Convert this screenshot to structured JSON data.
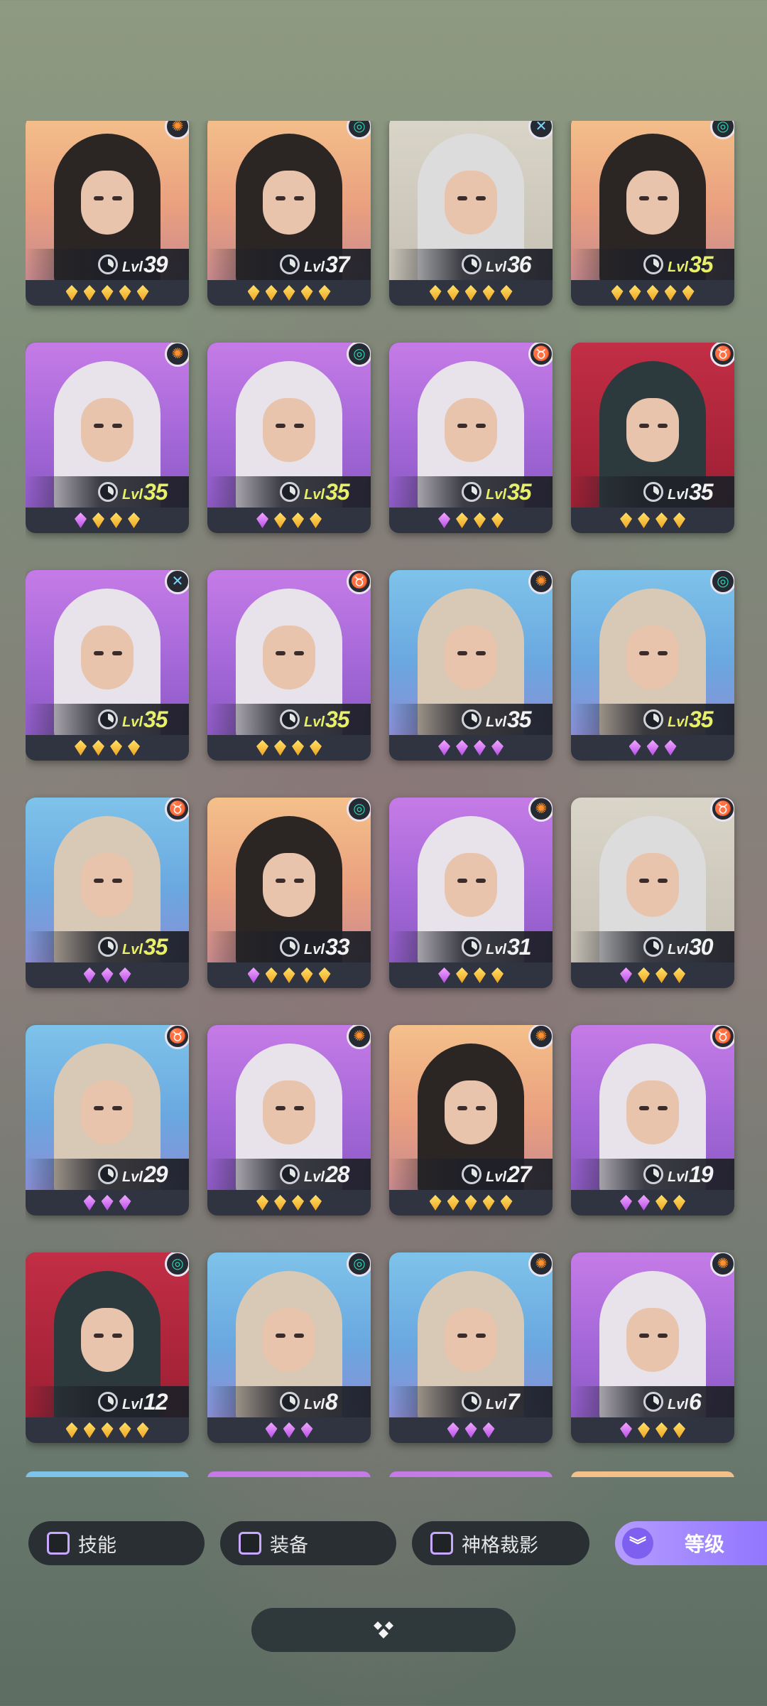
{
  "colors": {
    "level_highlight": "#e8f06a",
    "gem_gold": "#f0a321",
    "gem_purple": "#b74ee6",
    "sort_accent": "#8f73ff"
  },
  "heroes": [
    {
      "level_prefix": "Lvl",
      "level": "39",
      "faction": "orange",
      "faction_icon": "sun-icon",
      "bg": "orange",
      "gems": [
        "gold",
        "gold",
        "gold",
        "gold",
        "gold"
      ],
      "level_white": true
    },
    {
      "level_prefix": "Lvl",
      "level": "37",
      "faction": "teal",
      "faction_icon": "swirl-icon",
      "bg": "orange",
      "gems": [
        "gold",
        "gold",
        "gold",
        "gold",
        "gold"
      ],
      "level_white": true
    },
    {
      "level_prefix": "Lvl",
      "level": "36",
      "faction": "cyan",
      "faction_icon": "cross-icon",
      "bg": "gray",
      "gems": [
        "gold",
        "gold",
        "gold",
        "gold",
        "gold"
      ],
      "level_white": true
    },
    {
      "level_prefix": "Lvl",
      "level": "35",
      "faction": "teal",
      "faction_icon": "swirl-icon",
      "bg": "orange",
      "gems": [
        "gold",
        "gold",
        "gold",
        "gold",
        "gold"
      ],
      "level_white": false
    },
    {
      "level_prefix": "Lvl",
      "level": "35",
      "faction": "orange",
      "faction_icon": "sun-icon",
      "bg": "purple",
      "gems": [
        "purple",
        "gold",
        "gold",
        "gold"
      ],
      "level_white": false
    },
    {
      "level_prefix": "Lvl",
      "level": "35",
      "faction": "teal",
      "faction_icon": "swirl-icon",
      "bg": "purple",
      "gems": [
        "purple",
        "gold",
        "gold",
        "gold"
      ],
      "level_white": false
    },
    {
      "level_prefix": "Lvl",
      "level": "35",
      "faction": "purple",
      "faction_icon": "horns-icon",
      "bg": "purple",
      "gems": [
        "purple",
        "gold",
        "gold",
        "gold"
      ],
      "level_white": false
    },
    {
      "level_prefix": "Lvl",
      "level": "35",
      "faction": "purple",
      "faction_icon": "horns-icon",
      "bg": "red",
      "gems": [
        "gold",
        "gold",
        "gold",
        "gold"
      ],
      "level_white": true
    },
    {
      "level_prefix": "Lvl",
      "level": "35",
      "faction": "cyan",
      "faction_icon": "cross-icon",
      "bg": "purple",
      "gems": [
        "gold",
        "gold",
        "gold",
        "gold"
      ],
      "level_white": false
    },
    {
      "level_prefix": "Lvl",
      "level": "35",
      "faction": "purple",
      "faction_icon": "horns-icon",
      "bg": "purple",
      "gems": [
        "gold",
        "gold",
        "gold",
        "gold"
      ],
      "level_white": false
    },
    {
      "level_prefix": "Lvl",
      "level": "35",
      "faction": "orange",
      "faction_icon": "sun-icon",
      "bg": "blue",
      "gems": [
        "purple",
        "purple",
        "purple",
        "purple"
      ],
      "level_white": true
    },
    {
      "level_prefix": "Lvl",
      "level": "35",
      "faction": "teal",
      "faction_icon": "swirl-icon",
      "bg": "blue",
      "gems": [
        "purple",
        "purple",
        "purple"
      ],
      "level_white": false
    },
    {
      "level_prefix": "Lvl",
      "level": "35",
      "faction": "purple",
      "faction_icon": "horns-icon",
      "bg": "blue",
      "gems": [
        "purple",
        "purple",
        "purple"
      ],
      "level_white": false
    },
    {
      "level_prefix": "Lvl",
      "level": "33",
      "faction": "teal",
      "faction_icon": "swirl-icon",
      "bg": "orange",
      "gems": [
        "purple",
        "gold",
        "gold",
        "gold",
        "gold"
      ],
      "level_white": true
    },
    {
      "level_prefix": "Lvl",
      "level": "31",
      "faction": "orange",
      "faction_icon": "sun-icon",
      "bg": "purple",
      "gems": [
        "purple",
        "gold",
        "gold",
        "gold"
      ],
      "level_white": true
    },
    {
      "level_prefix": "Lvl",
      "level": "30",
      "faction": "purple",
      "faction_icon": "horns-icon",
      "bg": "gray",
      "gems": [
        "purple",
        "gold",
        "gold",
        "gold"
      ],
      "level_white": true
    },
    {
      "level_prefix": "Lvl",
      "level": "29",
      "faction": "purple",
      "faction_icon": "horns-icon",
      "bg": "blue",
      "gems": [
        "purple",
        "purple",
        "purple"
      ],
      "level_white": true
    },
    {
      "level_prefix": "Lvl",
      "level": "28",
      "faction": "orange",
      "faction_icon": "sun-icon",
      "bg": "purple",
      "gems": [
        "gold",
        "gold",
        "gold",
        "gold"
      ],
      "level_white": true
    },
    {
      "level_prefix": "Lvl",
      "level": "27",
      "faction": "orange",
      "faction_icon": "sun-icon",
      "bg": "orange",
      "gems": [
        "gold",
        "gold",
        "gold",
        "gold",
        "gold"
      ],
      "level_white": true
    },
    {
      "level_prefix": "Lvl",
      "level": "19",
      "faction": "purple",
      "faction_icon": "horns-icon",
      "bg": "purple",
      "gems": [
        "purple",
        "purple",
        "gold",
        "gold"
      ],
      "level_white": true
    },
    {
      "level_prefix": "Lvl",
      "level": "12",
      "faction": "teal",
      "faction_icon": "swirl-icon",
      "bg": "red",
      "gems": [
        "gold",
        "gold",
        "gold",
        "gold",
        "gold"
      ],
      "level_white": true
    },
    {
      "level_prefix": "Lvl",
      "level": "8",
      "faction": "teal",
      "faction_icon": "swirl-icon",
      "bg": "blue",
      "gems": [
        "purple",
        "purple",
        "purple"
      ],
      "level_white": true
    },
    {
      "level_prefix": "Lvl",
      "level": "7",
      "faction": "orange",
      "faction_icon": "sun-icon",
      "bg": "blue",
      "gems": [
        "purple",
        "purple",
        "purple"
      ],
      "level_white": true
    },
    {
      "level_prefix": "Lvl",
      "level": "6",
      "faction": "orange",
      "faction_icon": "sun-icon",
      "bg": "purple",
      "gems": [
        "purple",
        "gold",
        "gold",
        "gold"
      ],
      "level_white": true
    }
  ],
  "filters": {
    "skills_label": "技能",
    "equipment_label": "装备",
    "divinity_label": "神格裁影"
  },
  "sort": {
    "label": "等级",
    "icon": "chevrons-down-icon"
  },
  "expand_icon": "diamond-cluster-icon"
}
